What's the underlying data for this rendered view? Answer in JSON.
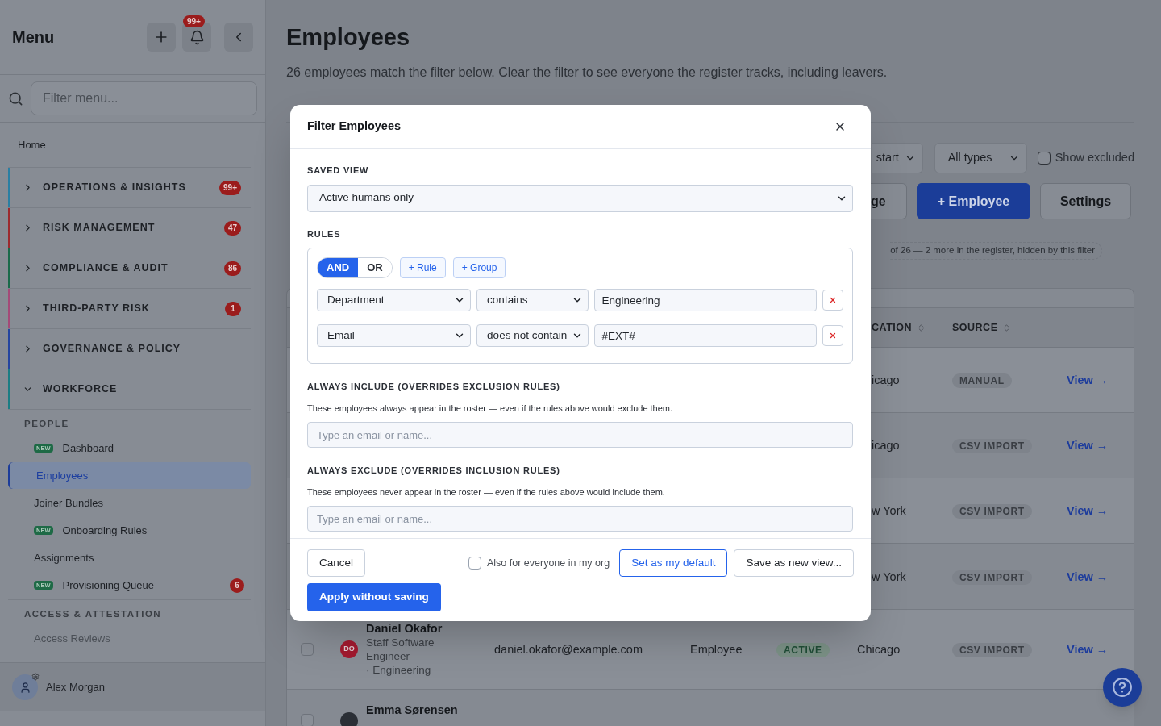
{
  "sidebar": {
    "title": "Menu",
    "notification_count": "99+",
    "filter": {
      "placeholder": "Filter menu..."
    },
    "home": "Home",
    "sections": [
      {
        "label": "OPERATIONS & INSIGHTS",
        "color": "#2a7fa3",
        "badge": "99+",
        "expanded": false
      },
      {
        "label": "RISK MANAGEMENT",
        "color": "#9c2a2e",
        "badge": "47",
        "expanded": false
      },
      {
        "label": "COMPLIANCE & AUDIT",
        "color": "#1a6a4a",
        "badge": "86",
        "expanded": false
      },
      {
        "label": "THIRD-PARTY RISK",
        "color": "#a44a78",
        "badge": "1",
        "expanded": false
      },
      {
        "label": "GOVERNANCE & POLICY",
        "color": "#2445a0",
        "expanded": false
      },
      {
        "label": "WORKFORCE",
        "color": "#1b7d84",
        "expanded": true,
        "children": [
          {
            "label": "PEOPLE",
            "children": [
              {
                "label": "Dashboard",
                "new": true,
                "new_label": "NEW",
                "selected": false
              },
              {
                "label": "Employees",
                "new": false,
                "selected": true
              },
              {
                "label": "Joiner Bundles",
                "new": false,
                "selected": false
              },
              {
                "label": "Onboarding Rules",
                "new": true,
                "new_label": "NEW",
                "selected": false
              },
              {
                "label": "Assignments",
                "new": false,
                "selected": false
              },
              {
                "label": "Provisioning Queue",
                "new": true,
                "new_label": "NEW",
                "selected": false,
                "badge": "6"
              }
            ]
          },
          {
            "label": "ACCESS & ATTESTATION",
            "children": [
              {
                "label": "Access Reviews",
                "new": false,
                "selected": false
              }
            ]
          }
        ]
      }
    ],
    "user": {
      "name": "Alex Morgan"
    }
  },
  "page": {
    "title": "Employees",
    "subtitle": "26 employees match the filter below. Clear the filter to see everyone the register tracks, including leavers.",
    "filters": [
      {
        "value": "start"
      },
      {
        "value": "All types"
      }
    ],
    "show_excluded": {
      "label": "Show excluded",
      "checked": false
    },
    "buttons": [
      {
        "label": "ge",
        "kind": "secondary"
      },
      {
        "label": "+ Employee",
        "kind": "primary"
      },
      {
        "label": "Settings",
        "kind": "secondary"
      }
    ],
    "filter_note": "of 26 — 2 more in the register, hidden by this filter"
  },
  "table": {
    "columns": [
      "CATION",
      "SOURCE"
    ],
    "rows": [
      {
        "kind": "partial",
        "location": "icago",
        "source": "MANUAL",
        "action": "View →"
      },
      {
        "kind": "partial",
        "location": "icago",
        "source": "CSV IMPORT",
        "action": "View →"
      },
      {
        "kind": "partial",
        "location": "w York",
        "source": "CSV IMPORT",
        "action": "View →"
      },
      {
        "kind": "partial",
        "location": "w York",
        "source": "CSV IMPORT",
        "action": "View →"
      },
      {
        "kind": "full",
        "initials": "DO",
        "color": "#a3192f",
        "name": "Daniel Okafor",
        "job": "Staff Software Engineer",
        "department": "· Engineering",
        "email": "daniel.okafor@example.com",
        "type": "Employee",
        "status": "ACTIVE",
        "location": "Chicago",
        "source": "CSV IMPORT",
        "action": "View →",
        "checked": false
      },
      {
        "kind": "cut",
        "name": "Emma Sørensen",
        "color": "#2b2f36",
        "checked": false
      }
    ]
  },
  "dialog": {
    "title": "Filter Employees",
    "saved_view": {
      "label": "SAVED VIEW",
      "value": "Active humans only"
    },
    "rules": {
      "label": "RULES",
      "logic": [
        {
          "label": "AND",
          "selected": true
        },
        {
          "label": "OR",
          "selected": false
        }
      ],
      "add_buttons": [
        "+ Rule",
        "+ Group"
      ],
      "items": [
        {
          "field": "Department",
          "operator": "contains",
          "value": "Engineering"
        },
        {
          "field": "Email",
          "operator": "does not contain",
          "value": "#EXT#"
        }
      ]
    },
    "include": {
      "label": "ALWAYS INCLUDE (OVERRIDES EXCLUSION RULES)",
      "description": "These employees always appear in the roster — even if the rules above would exclude them.",
      "placeholder": "Type an email or name..."
    },
    "exclude": {
      "label": "ALWAYS EXCLUDE (OVERRIDES INCLUSION RULES)",
      "description": "These employees never appear in the roster — even if the rules above would include them.",
      "placeholder": "Type an email or name..."
    },
    "cancel": "Cancel",
    "org_wide": {
      "label": "Also for everyone in my org",
      "checked": false
    },
    "set_default": "Set as my default",
    "save_new": "Save as new view...",
    "apply": "Apply without saving"
  }
}
